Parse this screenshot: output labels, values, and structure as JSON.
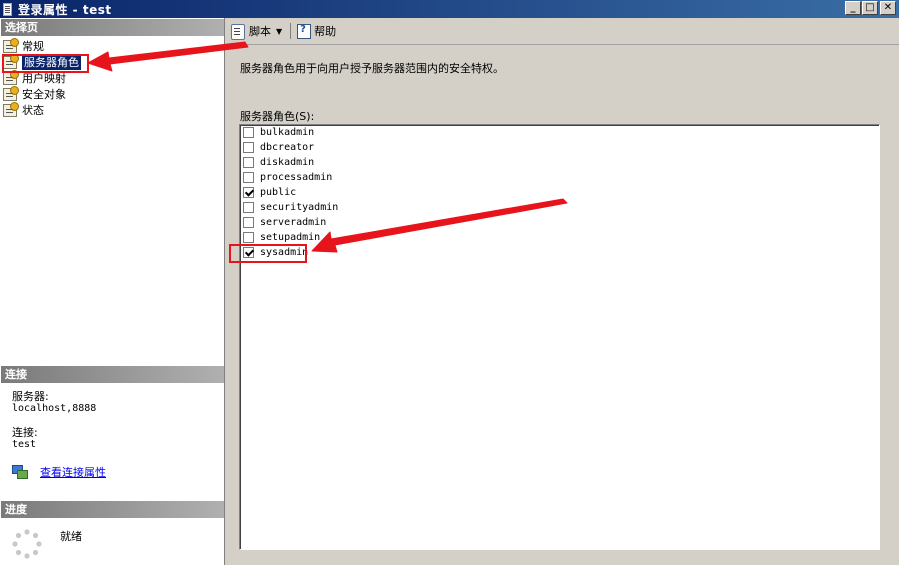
{
  "window": {
    "title": "登录属性 - test",
    "controls": {
      "minimize": "_",
      "maximize": "□",
      "close": "✕"
    }
  },
  "left_pane": {
    "select_page_header": "选择页",
    "pages": [
      {
        "label": "常规",
        "icon": "page-icon"
      },
      {
        "label": "服务器角色",
        "icon": "page-icon",
        "selected": true
      },
      {
        "label": "用户映射",
        "icon": "page-icon"
      },
      {
        "label": "安全对象",
        "icon": "page-icon"
      },
      {
        "label": "状态",
        "icon": "page-icon"
      }
    ],
    "connection": {
      "header": "连接",
      "server_label": "服务器:",
      "server_value": "localhost,8888",
      "connection_label": "连接:",
      "connection_value": "test",
      "view_link": "查看连接属性"
    },
    "progress": {
      "header": "进度",
      "status": "就绪"
    }
  },
  "toolbar": {
    "script_label": "脚本",
    "help_label": "帮助"
  },
  "content": {
    "description": "服务器角色用于向用户授予服务器范围内的安全特权。",
    "roles_label": "服务器角色(S):",
    "roles": [
      {
        "name": "bulkadmin",
        "checked": false
      },
      {
        "name": "dbcreator",
        "checked": false
      },
      {
        "name": "diskadmin",
        "checked": false
      },
      {
        "name": "processadmin",
        "checked": false
      },
      {
        "name": "public",
        "checked": true
      },
      {
        "name": "securityadmin",
        "checked": false
      },
      {
        "name": "serveradmin",
        "checked": false
      },
      {
        "name": "setupadmin",
        "checked": false
      },
      {
        "name": "sysadmin",
        "checked": true
      }
    ]
  },
  "colors": {
    "annotation": "#e8141c",
    "selection": "#0a246a",
    "title_bar": "#0a246a"
  }
}
